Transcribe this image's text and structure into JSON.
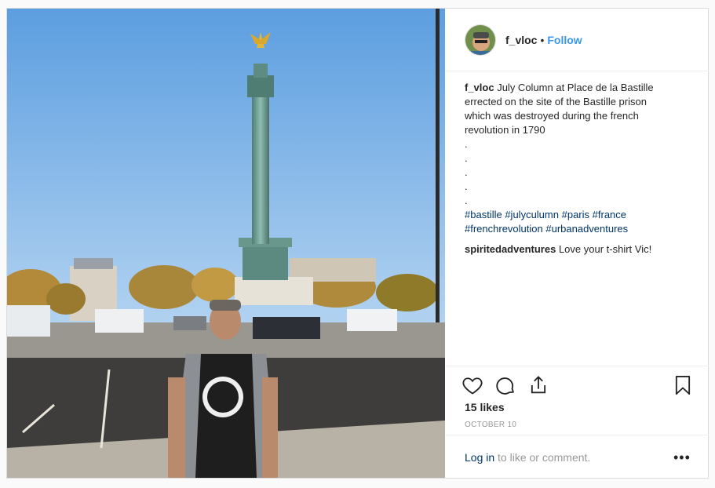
{
  "post": {
    "username": "f_vloc",
    "separator": "•",
    "follow_label": "Follow",
    "caption_lines": [
      "July Column at Place de la Bastille",
      "errected on the site of the Bastille prison",
      "which was destroyed during the french",
      "revolution in 1790"
    ],
    "dots": [
      ".",
      ".",
      ".",
      ".",
      "."
    ],
    "hashtags_line1": [
      "#bastille",
      "#julyculumn",
      "#paris",
      "#france"
    ],
    "hashtags_line2": [
      "#frenchrevolution",
      "#urbanadventures"
    ],
    "comment": {
      "username": "spiritedadventures",
      "text": "Love your t-shirt Vic!"
    },
    "likes": "15 likes",
    "date": "OCTOBER 10",
    "login_link": "Log in",
    "login_text": " to like or comment.",
    "more_label": "•••"
  },
  "icons": {
    "like": "heart-icon",
    "comment": "comment-icon",
    "share": "share-icon",
    "save": "bookmark-icon"
  }
}
